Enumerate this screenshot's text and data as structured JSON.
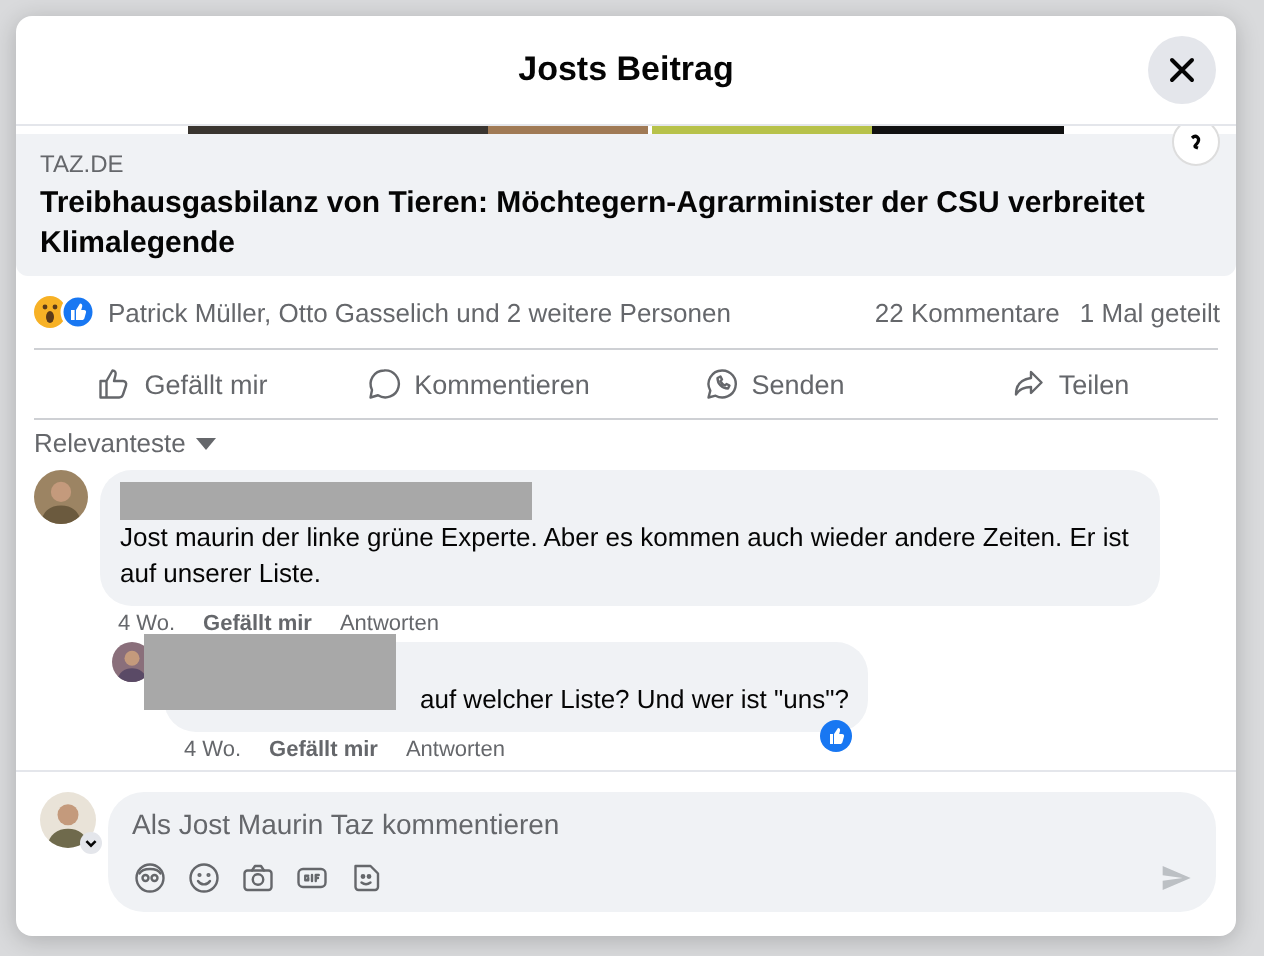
{
  "dialog": {
    "title": "Josts Beitrag"
  },
  "link_preview": {
    "domain": "TAZ.DE",
    "headline": "Treibhausgasbilanz von Tieren: Möchtegern-Agrarminister der CSU verbreitet Klimalegende"
  },
  "reactions": {
    "names": "Patrick Müller, Otto Gasselich und 2 weitere Personen",
    "comments": "22 Kommentare",
    "shares": "1 Mal geteilt"
  },
  "actions": [
    {
      "kind": "like",
      "label": "Gefällt mir"
    },
    {
      "kind": "comment",
      "label": "Kommentieren"
    },
    {
      "kind": "send",
      "label": "Senden"
    },
    {
      "kind": "share",
      "label": "Teilen"
    }
  ],
  "sort": {
    "label": "Relevanteste"
  },
  "comments": [
    {
      "text": "Jost maurin der linke grüne Experte. Aber es kommen auch wieder andere Zeiten. Er ist auf unserer Liste.",
      "time": "4 Wo.",
      "like": "Gefällt mir",
      "reply": "Antworten",
      "reacted": false,
      "children": [
        {
          "text": "auf welcher Liste? Und wer ist \"uns\"?",
          "time": "4 Wo.",
          "like": "Gefällt mir",
          "reply": "Antworten",
          "reacted": true
        }
      ]
    }
  ],
  "composer": {
    "placeholder": "Als Jost Maurin Taz kommentieren",
    "tools": [
      {
        "kind": "avatar"
      },
      {
        "kind": "emoji"
      },
      {
        "kind": "camera"
      },
      {
        "kind": "gif"
      },
      {
        "kind": "sticker"
      }
    ]
  }
}
